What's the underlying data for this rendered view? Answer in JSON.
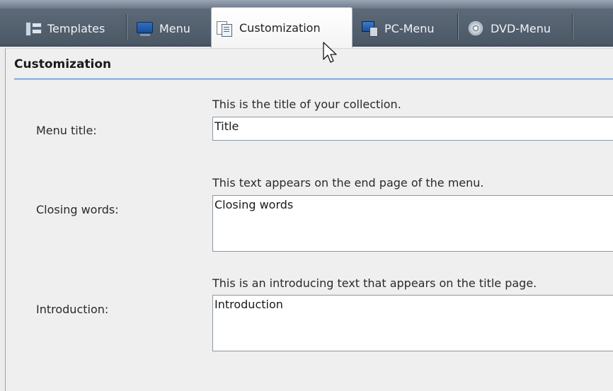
{
  "tabs": [
    {
      "label": "Templates",
      "icon": "templates-icon",
      "active": false
    },
    {
      "label": "Menu",
      "icon": "menu-icon",
      "active": false
    },
    {
      "label": "Customization",
      "icon": "customization-icon",
      "active": true
    },
    {
      "label": "PC-Menu",
      "icon": "pc-menu-icon",
      "active": false
    },
    {
      "label": "DVD-Menu",
      "icon": "dvd-menu-icon",
      "active": false
    }
  ],
  "section": {
    "title": "Customization"
  },
  "fields": {
    "menu_title": {
      "label": "Menu title:",
      "hint": "This is the title of your collection.",
      "value": "Title"
    },
    "closing_words": {
      "label": "Closing words:",
      "hint": "This text appears on the end page of the menu.",
      "value": "Closing words"
    },
    "introduction": {
      "label": "Introduction:",
      "hint": "This is an introducing text that appears on the title page.",
      "value": "Introduction"
    }
  },
  "colors": {
    "tabbar": "#4b5866",
    "accent_rule": "#5f94d6",
    "panel": "#efefef"
  }
}
